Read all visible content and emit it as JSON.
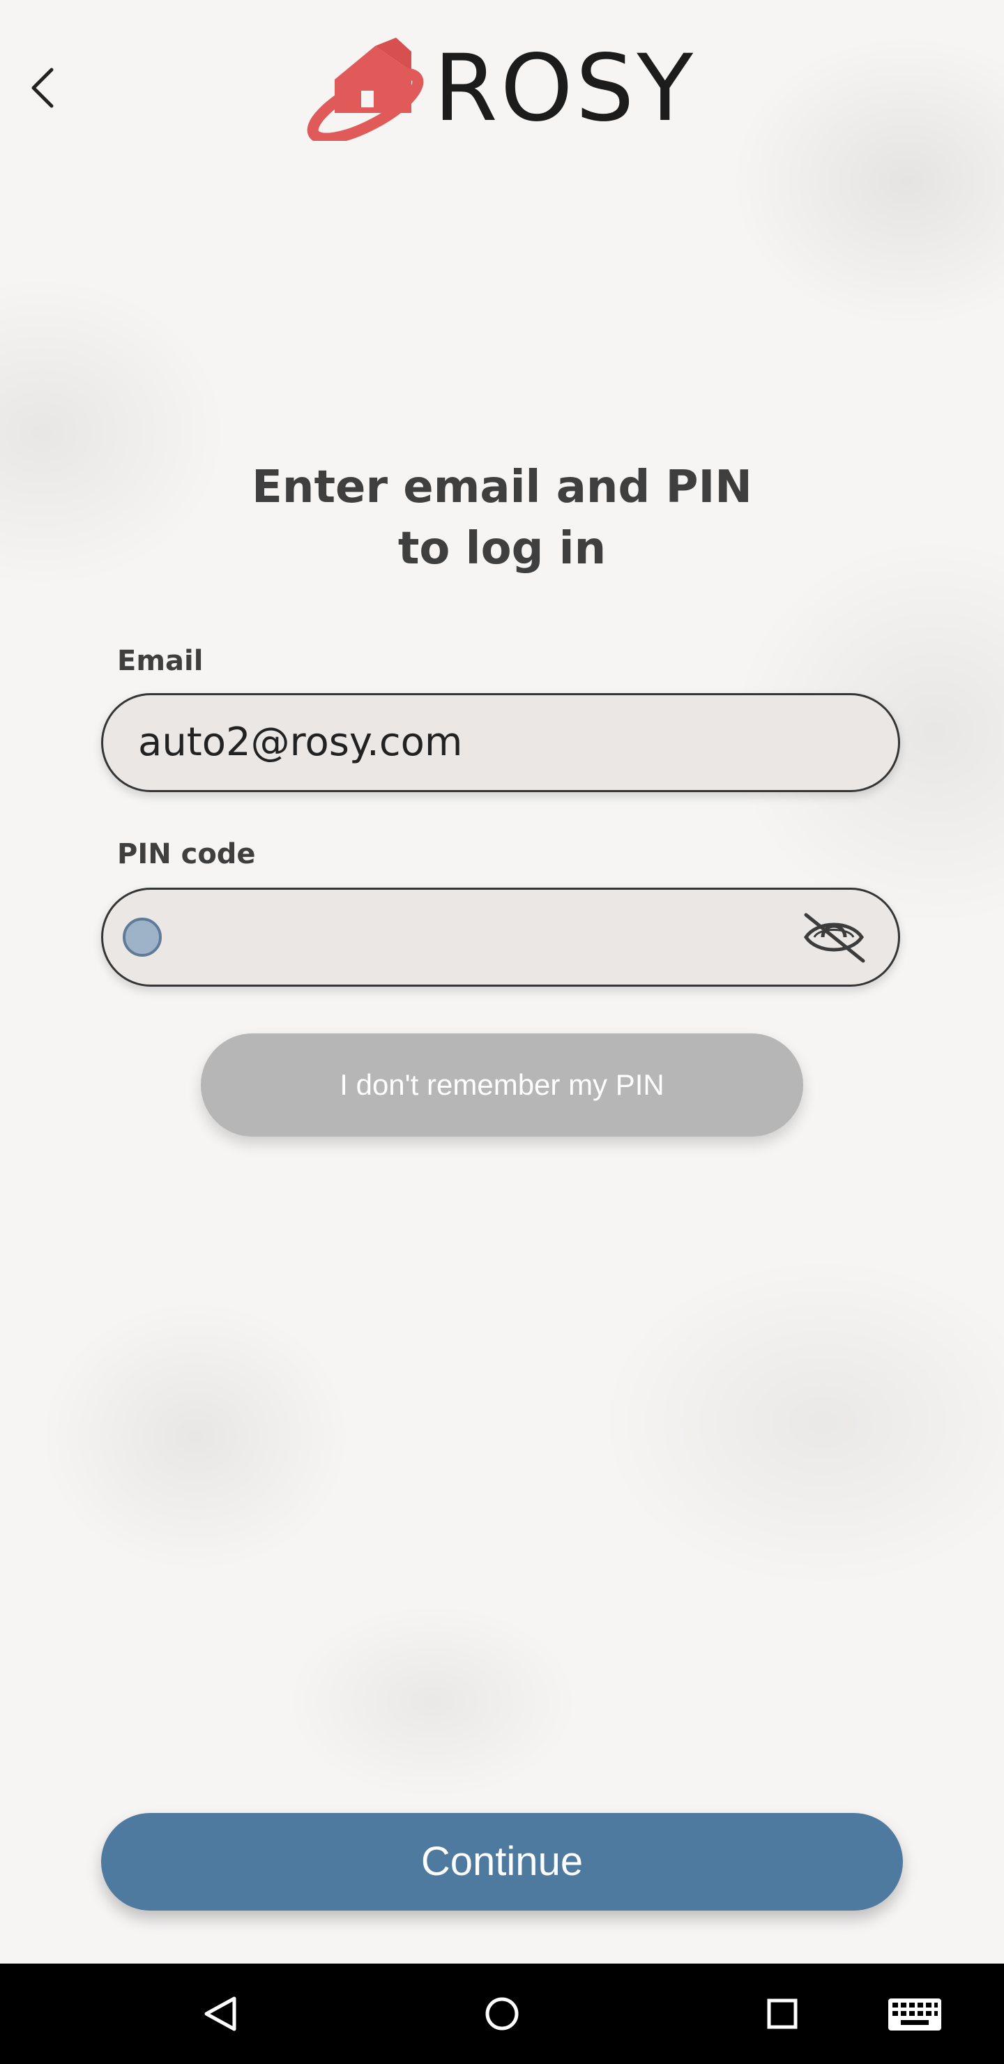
{
  "app": {
    "brand": "ROSY",
    "brand_color": "#e05a5a"
  },
  "header": {
    "back_icon": "chevron-left-icon"
  },
  "login": {
    "heading_line1": "Enter email and PIN",
    "heading_line2": "to log in",
    "email_label": "Email",
    "email_value": "auto2@rosy.com",
    "pin_label": "PIN code",
    "pin_value": "",
    "pin_visibility_icon": "eye-off-icon",
    "forgot_pin_label": "I don't remember my PIN",
    "forgot_pin_state": "disabled",
    "continue_label": "Continue"
  },
  "colors": {
    "primary": "#4e7aa0",
    "disabled": "#b6b6b6",
    "input_bg": "#ebe7e5",
    "text": "#3f3f3f"
  },
  "system_nav": {
    "icons": [
      "back-triangle-icon",
      "home-circle-icon",
      "recents-square-icon",
      "keyboard-icon"
    ]
  }
}
